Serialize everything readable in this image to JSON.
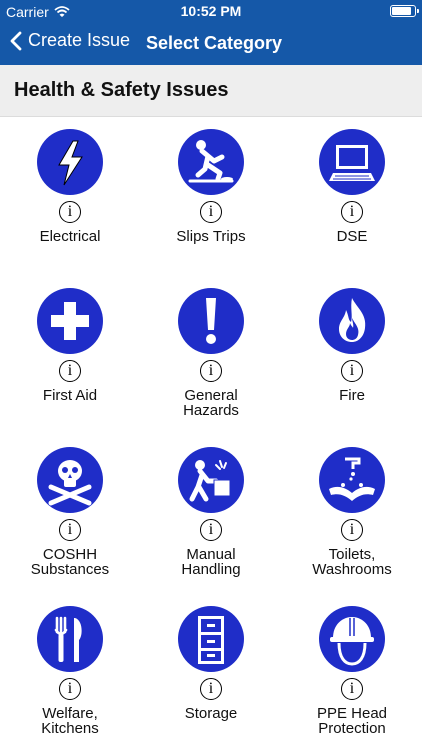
{
  "status_bar": {
    "carrier": "Carrier",
    "time": "10:52 PM"
  },
  "nav": {
    "back_label": "Create Issue",
    "title": "Select Category"
  },
  "section": {
    "title": "Health & Safety Issues"
  },
  "categories": [
    {
      "label": "Electrical",
      "icon": "lightning-bolt-icon"
    },
    {
      "label": "Slips Trips",
      "icon": "slipping-person-icon"
    },
    {
      "label": "DSE",
      "icon": "computer-monitor-icon"
    },
    {
      "label": "First Aid",
      "icon": "first-aid-cross-icon"
    },
    {
      "label": "General\nHazards",
      "icon": "exclamation-icon"
    },
    {
      "label": "Fire",
      "icon": "flame-icon"
    },
    {
      "label": "COSHH\nSubstances",
      "icon": "skull-crossbones-icon"
    },
    {
      "label": "Manual\nHandling",
      "icon": "lifting-box-icon"
    },
    {
      "label": "Toilets,\nWashrooms",
      "icon": "hand-washing-icon"
    },
    {
      "label": "Welfare,\nKitchens",
      "icon": "fork-knife-icon"
    },
    {
      "label": "Storage",
      "icon": "filing-cabinet-icon"
    },
    {
      "label": "PPE Head\nProtection",
      "icon": "hard-hat-icon"
    }
  ],
  "info_glyph": "i",
  "colors": {
    "nav_bar": "#1558a8",
    "icon_circle": "#1f2dc8",
    "section_bg": "#eeeeee"
  }
}
